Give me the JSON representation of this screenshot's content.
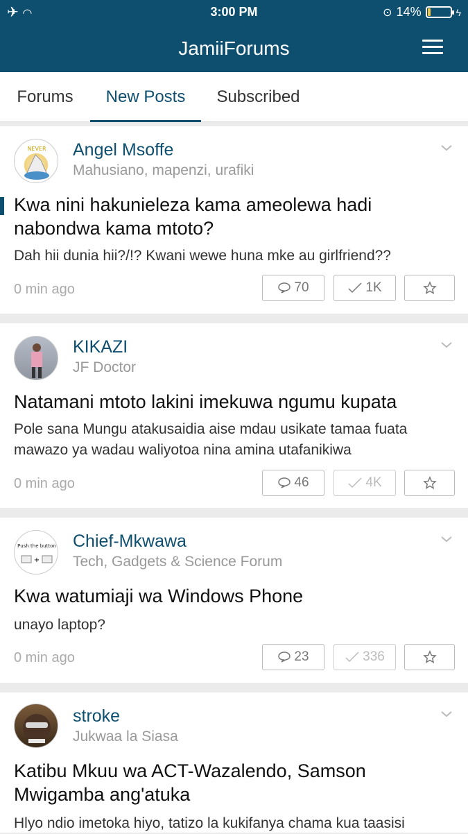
{
  "status": {
    "time": "3:00 PM",
    "battery": "14%",
    "battery_level": 0.14
  },
  "header": {
    "title": "JamiiForums"
  },
  "tabs": [
    {
      "label": "Forums"
    },
    {
      "label": "New Posts"
    },
    {
      "label": "Subscribed"
    }
  ],
  "posts": [
    {
      "user": "Angel Msoffe",
      "forum": "Mahusiano, mapenzi, urafiki",
      "title_lines": [
        "Kwa nini hakunieleza kama ameolewa  hadi",
        "nabondwa kama mtoto?"
      ],
      "snippet_lines": [
        "Dah hii dunia hii?/!? Kwani wewe huna mke au girlfriend??"
      ],
      "time": "0 min ago",
      "replies": "70",
      "likes": "1K"
    },
    {
      "user": "KIKAZI",
      "forum": "JF Doctor",
      "title_lines": [
        "Natamani mtoto lakini imekuwa ngumu kupata"
      ],
      "snippet_lines": [
        "Pole sana Mungu atakusaidia aise mdau usikate tamaa fuata",
        "mawazo ya wadau waliyotoa nina amina utafanikiwa"
      ],
      "time": "0 min ago",
      "replies": "46",
      "likes": "4K"
    },
    {
      "user": "Chief-Mkwawa",
      "forum": "Tech, Gadgets & Science Forum",
      "avatar_text": "Push the button",
      "title_lines": [
        "Kwa watumiaji wa Windows Phone"
      ],
      "snippet_lines": [
        "unayo laptop?"
      ],
      "time": "0 min ago",
      "replies": "23",
      "likes": "336"
    },
    {
      "user": "stroke",
      "forum": "Jukwaa la Siasa",
      "title_lines": [
        "Katibu Mkuu wa ACT-Wazalendo, Samson",
        "Mwigamba ang'atuka"
      ],
      "snippet_lines": [
        "Hlyo ndio imetoka hiyo, tatizo la kukifanya chama kua taasisi"
      ]
    }
  ]
}
